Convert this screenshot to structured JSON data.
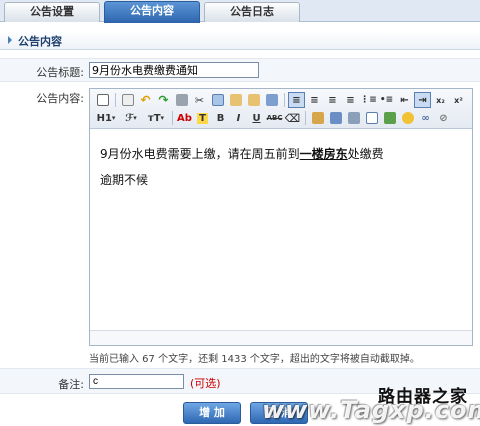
{
  "tabs": [
    {
      "label": "公告设置"
    },
    {
      "label": "公告内容"
    },
    {
      "label": "公告日志"
    }
  ],
  "section": {
    "title": "公告内容"
  },
  "form": {
    "title_label": "公告标题:",
    "title_value": "9月份水电费缴费通知",
    "content_label": "公告内容:",
    "note_label": "备注:",
    "note_value": "c",
    "note_hint": "(可选)"
  },
  "editor": {
    "toolbar_row2_text": {
      "heading": "H1",
      "font": "ℱ",
      "size": "тT",
      "bgcolor": "Ab",
      "bold": "B",
      "italic": "I",
      "underline": "U",
      "strike": "ABC"
    },
    "line1_pre": "9月份水电费需要上缴，请在周五前到",
    "line1_bold": "一楼房东",
    "line1_post": "处缴费",
    "line2": "逾期不候"
  },
  "counter": "当前已输入 67 个文字，还剩 1433 个文字，超出的文字将被自动截取掉。",
  "buttons": {
    "add": "增 加",
    "cancel": "取 消"
  },
  "watermark": {
    "cn": "路由器之家",
    "url": "www.Tagxp.com"
  }
}
